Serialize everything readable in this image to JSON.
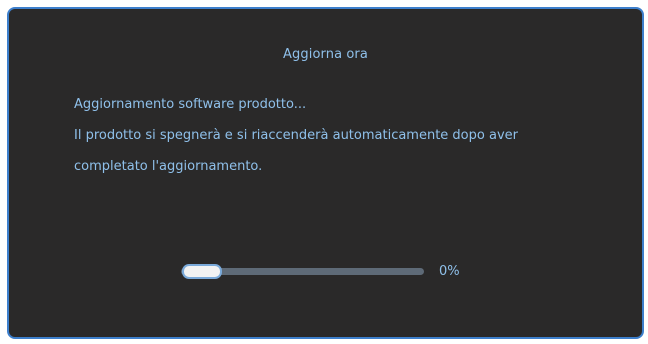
{
  "dialog": {
    "title": "Aggiorna ora",
    "message_lines": [
      "Aggiornamento software prodotto...",
      "Il prodotto si spegnerà e si riaccenderà automaticamente dopo aver",
      "completato l'aggiornamento."
    ]
  },
  "progress": {
    "percent": 0,
    "label": "0%"
  },
  "colors": {
    "background": "#2a2929",
    "text": "#8fc0ea",
    "border_accent": "#3d7fcc",
    "track": "#5e6a77",
    "knob": "#f2f2f2"
  }
}
